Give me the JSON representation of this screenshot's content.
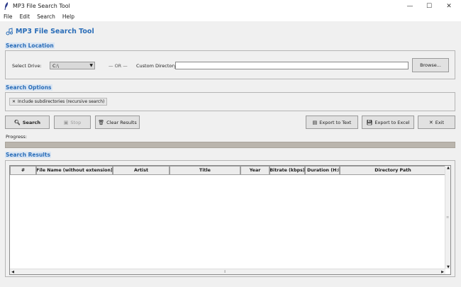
{
  "window": {
    "title": "MP3 File Search Tool",
    "minimize": "—",
    "maximize": "☐",
    "close": "✕"
  },
  "menu": [
    "File",
    "Edit",
    "Search",
    "Help"
  ],
  "app_title": "MP3 File Search Tool",
  "search_location": {
    "section_label": "Search Location",
    "drive_label": "Select Drive:",
    "drive_value": "C:\\",
    "or_text": "— OR —",
    "custom_dir_label": "Custom Directory:",
    "custom_dir_value": "",
    "browse_label": "Browse..."
  },
  "search_options": {
    "section_label": "Search Options",
    "include_subdirs": {
      "checked": true,
      "mark": "✕",
      "label": "Include subdirectories (recursive search)"
    }
  },
  "actions": {
    "search": "Search",
    "stop": "Stop",
    "clear": "Clear Results",
    "export_text": "Export to Text",
    "export_excel": "Export to Excel",
    "exit": "Exit"
  },
  "progress": {
    "label": "Progress:",
    "value": 0
  },
  "results": {
    "section_label": "Search Results",
    "columns": [
      "#",
      "File Name (without extension)",
      "Artist",
      "Title",
      "Year",
      "Bitrate (kbps)",
      "Duration (H:M",
      "Directory Path"
    ],
    "rows": []
  },
  "colors": {
    "accent": "#2a6db8",
    "section_bg": "#dbe6f3",
    "window_bg": "#f0f0f0",
    "progress_bg": "#bab5ad"
  },
  "icons": {
    "app": "feather-icon",
    "heading": "music-search-icon",
    "search": "magnifier-icon",
    "stop": "stop-icon",
    "clear": "trash-icon",
    "export_text": "document-icon",
    "export_excel": "save-icon",
    "exit": "close-icon"
  }
}
